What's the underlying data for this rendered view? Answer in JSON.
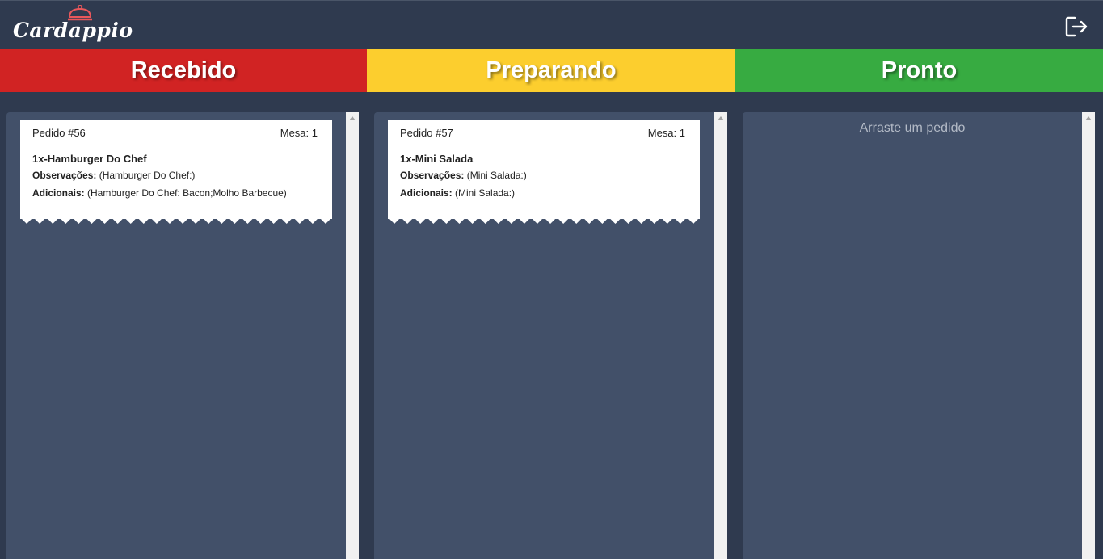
{
  "app": {
    "logo_text": "Cardappio",
    "logo_icon": "cloche-icon",
    "logout_icon": "logout-icon"
  },
  "statuses": [
    {
      "label": "Recebido",
      "color": "#d12323"
    },
    {
      "label": "Preparando",
      "color": "#fcce2e"
    },
    {
      "label": "Pronto",
      "color": "#37ab41"
    }
  ],
  "columns": [
    {
      "tickets": [
        {
          "order": "Pedido #56",
          "table": "Mesa: 1",
          "item": "1x-Hamburger Do Chef",
          "obs_label": "Observações:",
          "obs_value": " (Hamburger Do Chef:)",
          "add_label": "Adicionais:",
          "add_value": " (Hamburger Do Chef: Bacon;Molho Barbecue)"
        }
      ]
    },
    {
      "tickets": [
        {
          "order": "Pedido #57",
          "table": "Mesa: 1",
          "item": "1x-Mini Salada",
          "obs_label": "Observações:",
          "obs_value": " (Mini Salada:)",
          "add_label": "Adicionais:",
          "add_value": " (Mini Salada:)"
        }
      ]
    },
    {
      "tickets": [],
      "empty_hint": "Arraste um pedido"
    }
  ]
}
